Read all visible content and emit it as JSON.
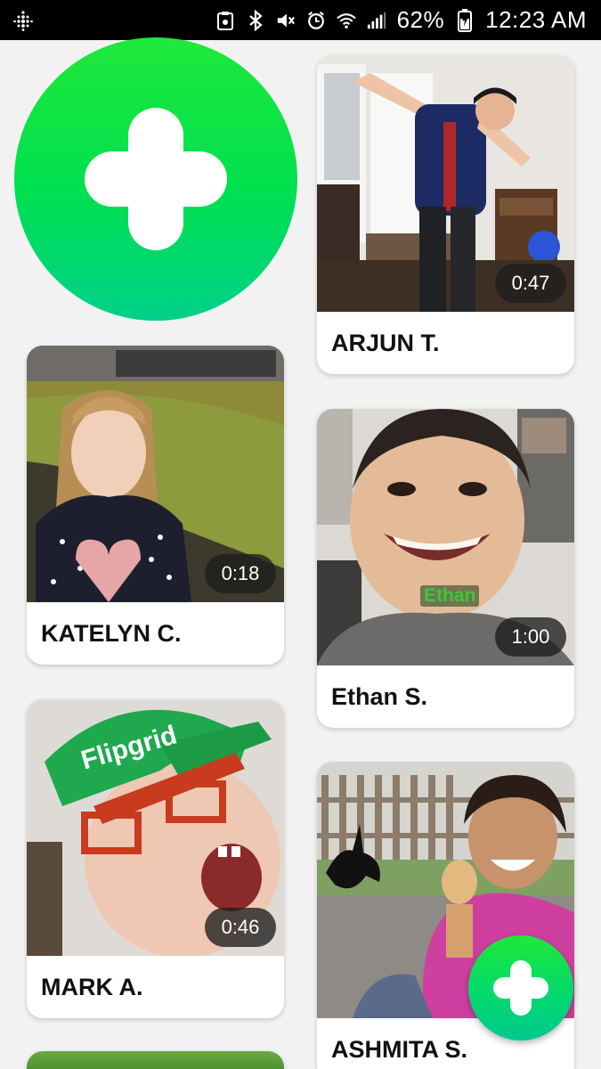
{
  "status_bar": {
    "battery": "62%",
    "time": "12:23 AM"
  },
  "add_button": {
    "icon": "plus-icon"
  },
  "fab": {
    "icon": "plus-icon"
  },
  "responses": [
    {
      "name": "ARJUN T.",
      "duration": "0:47"
    },
    {
      "name": "KATELYN C.",
      "duration": "0:18"
    },
    {
      "name": "Ethan S.",
      "duration": "1:00",
      "overlay_label": "Ethan"
    },
    {
      "name": "MARK A.",
      "duration": "0:46",
      "overlay_label": "Flipgrid"
    },
    {
      "name": "ASHMITA S."
    }
  ],
  "colors": {
    "accent_green": "#00e050",
    "status_bar": "#000000",
    "background": "#f2f2f2"
  }
}
